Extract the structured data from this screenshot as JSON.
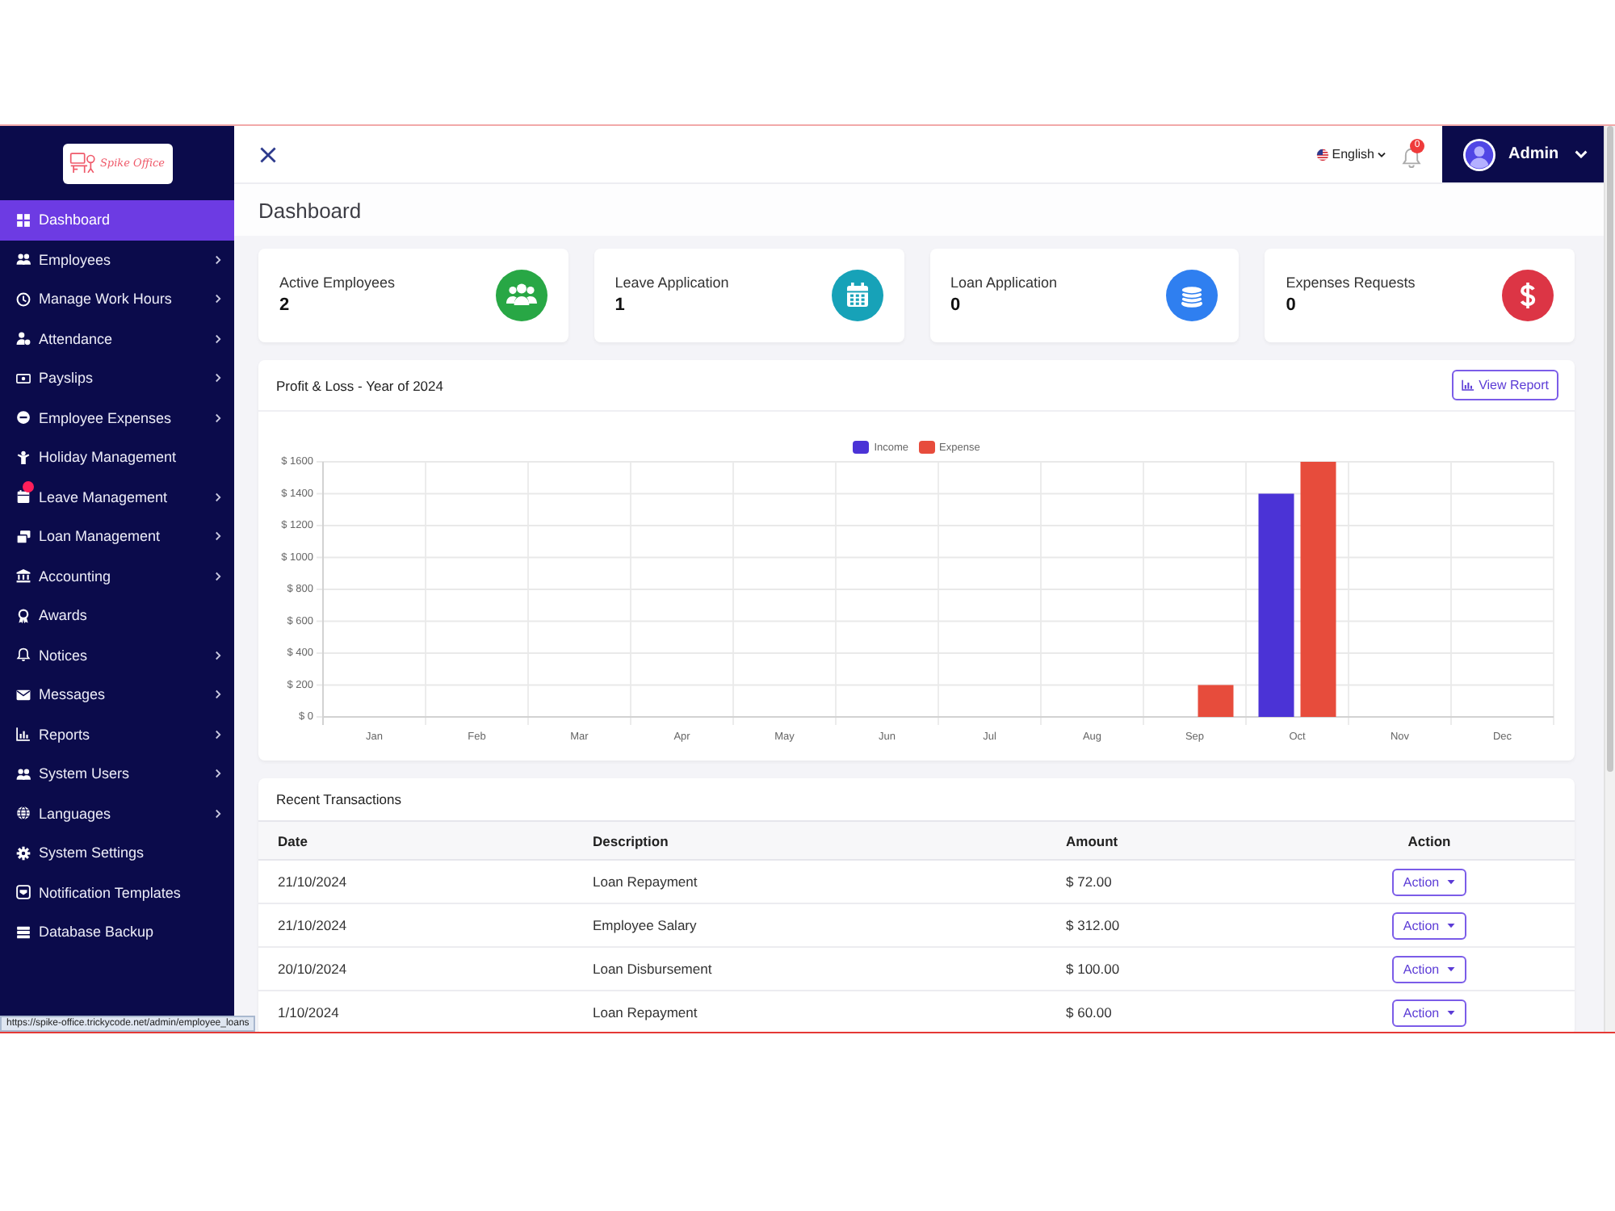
{
  "sidebar": {
    "logo": "Spike Office",
    "items": [
      {
        "label": "Dashboard",
        "selected": true,
        "expandable": false,
        "dot": false
      },
      {
        "label": "Employees",
        "selected": false,
        "expandable": true,
        "dot": false
      },
      {
        "label": "Manage Work Hours",
        "selected": false,
        "expandable": true,
        "dot": false
      },
      {
        "label": "Attendance",
        "selected": false,
        "expandable": true,
        "dot": false
      },
      {
        "label": "Payslips",
        "selected": false,
        "expandable": true,
        "dot": false
      },
      {
        "label": "Employee Expenses",
        "selected": false,
        "expandable": true,
        "dot": false
      },
      {
        "label": "Holiday Management",
        "selected": false,
        "expandable": false,
        "dot": false
      },
      {
        "label": "Leave Management",
        "selected": false,
        "expandable": true,
        "dot": true
      },
      {
        "label": "Loan Management",
        "selected": false,
        "expandable": true,
        "dot": false
      },
      {
        "label": "Accounting",
        "selected": false,
        "expandable": true,
        "dot": false
      },
      {
        "label": "Awards",
        "selected": false,
        "expandable": false,
        "dot": false
      },
      {
        "label": "Notices",
        "selected": false,
        "expandable": true,
        "dot": false
      },
      {
        "label": "Messages",
        "selected": false,
        "expandable": true,
        "dot": false
      },
      {
        "label": "Reports",
        "selected": false,
        "expandable": true,
        "dot": false
      },
      {
        "label": "System Users",
        "selected": false,
        "expandable": true,
        "dot": false
      },
      {
        "label": "Languages",
        "selected": false,
        "expandable": true,
        "dot": false
      },
      {
        "label": "System Settings",
        "selected": false,
        "expandable": false,
        "dot": false
      },
      {
        "label": "Notification Templates",
        "selected": false,
        "expandable": false,
        "dot": false
      },
      {
        "label": "Database Backup",
        "selected": false,
        "expandable": false,
        "dot": false
      }
    ]
  },
  "header": {
    "language": "English",
    "notification_count": "0",
    "user": "Admin"
  },
  "page_title": "Dashboard",
  "stat_cards": [
    {
      "title": "Active Employees",
      "value": "2",
      "color": "#28a745"
    },
    {
      "title": "Leave Application",
      "value": "1",
      "color": "#17a2b8"
    },
    {
      "title": "Loan Application",
      "value": "0",
      "color": "#2f7ff0"
    },
    {
      "title": "Expenses Requests",
      "value": "0",
      "color": "#dc3545"
    }
  ],
  "profit_loss": {
    "title": "Profit & Loss - Year of 2024",
    "button": "View Report",
    "chart_data": [
      {
        "type": "bar",
        "categories": [
          "Jan",
          "Feb",
          "Mar",
          "Apr",
          "May",
          "Jun",
          "Jul",
          "Aug",
          "Sep",
          "Oct",
          "Nov",
          "Dec"
        ],
        "series": [
          {
            "name": "Income",
            "color": "#4b33d6",
            "values": [
              0,
              0,
              0,
              0,
              0,
              0,
              0,
              0,
              0,
              1400,
              0,
              0
            ]
          },
          {
            "name": "Expense",
            "color": "#e74c3c",
            "values": [
              0,
              0,
              0,
              0,
              0,
              0,
              0,
              0,
              200,
              1600,
              0,
              0
            ]
          }
        ],
        "ylim": [
          0,
          1600
        ],
        "yticks": [
          {
            "value": 0,
            "label": "$ 0"
          },
          {
            "value": 200,
            "label": "$ 200"
          },
          {
            "value": 400,
            "label": "$ 400"
          },
          {
            "value": 600,
            "label": "$ 600"
          },
          {
            "value": 800,
            "label": "$ 800"
          },
          {
            "value": 1000,
            "label": "$ 1000"
          },
          {
            "value": 1200,
            "label": "$ 1200"
          },
          {
            "value": 1400,
            "label": "$ 1400"
          },
          {
            "value": 1600,
            "label": "$ 1600"
          }
        ],
        "legend": "top",
        "grid": true
      }
    ]
  },
  "recent_transactions": {
    "title": "Recent Transactions",
    "columns": [
      "Date",
      "Description",
      "Amount",
      "Action"
    ],
    "rows": [
      {
        "date": "21/10/2024",
        "description": "Loan Repayment",
        "amount": "$ 72.00",
        "action": "Action"
      },
      {
        "date": "21/10/2024",
        "description": "Employee Salary",
        "amount": "$ 312.00",
        "action": "Action"
      },
      {
        "date": "20/10/2024",
        "description": "Loan Disbursement",
        "amount": "$ 100.00",
        "action": "Action"
      },
      {
        "date": "1/10/2024",
        "description": "Loan Repayment",
        "amount": "$ 60.00",
        "action": "Action"
      }
    ]
  },
  "status_url": "https://spike-office.trickycode.net/admin/employee_loans"
}
